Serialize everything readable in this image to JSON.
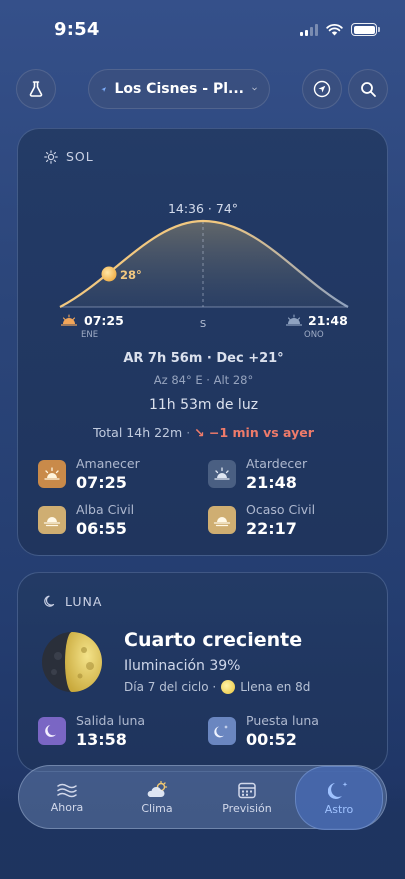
{
  "status": {
    "time": "9:54"
  },
  "header": {
    "location": "Los Cisnes - Pl..."
  },
  "sun": {
    "title": "SOL",
    "peak_label": "14:36 · 74°",
    "current_elevation": "28°",
    "sunrise_time": "07:25",
    "sunrise_dir": "ENE",
    "south_label": "S",
    "sunset_time": "21:48",
    "sunset_dir": "ONO",
    "ar_dec": "AR 7h 56m · Dec +21°",
    "az_alt": "Az 84° E · Alt 28°",
    "daylight": "11h 53m de luz",
    "total": "Total 14h 22m",
    "delta": "↘ −1 min vs ayer",
    "events": [
      {
        "label": "Amanecer",
        "value": "07:25",
        "color": "#c98a4a"
      },
      {
        "label": "Atardecer",
        "value": "21:48",
        "color": "#4a5f82"
      },
      {
        "label": "Alba Civil",
        "value": "06:55",
        "color": "#cfae72"
      },
      {
        "label": "Ocaso Civil",
        "value": "22:17",
        "color": "#cfae72"
      }
    ]
  },
  "moon": {
    "title": "LUNA",
    "phase": "Cuarto creciente",
    "illumination": "Iluminación 39%",
    "cycle_day": "Día 7 del ciclo ·",
    "full_moon": "Llena en 8d",
    "events": [
      {
        "label": "Salida luna",
        "value": "13:58",
        "color": "#7a66c4"
      },
      {
        "label": "Puesta luna",
        "value": "00:52",
        "color": "#6a86c0"
      }
    ]
  },
  "nav": {
    "items": [
      {
        "label": "Ahora"
      },
      {
        "label": "Clima"
      },
      {
        "label": "Previsión"
      },
      {
        "label": "Astro"
      }
    ],
    "active_color": "#9fc2ff"
  }
}
